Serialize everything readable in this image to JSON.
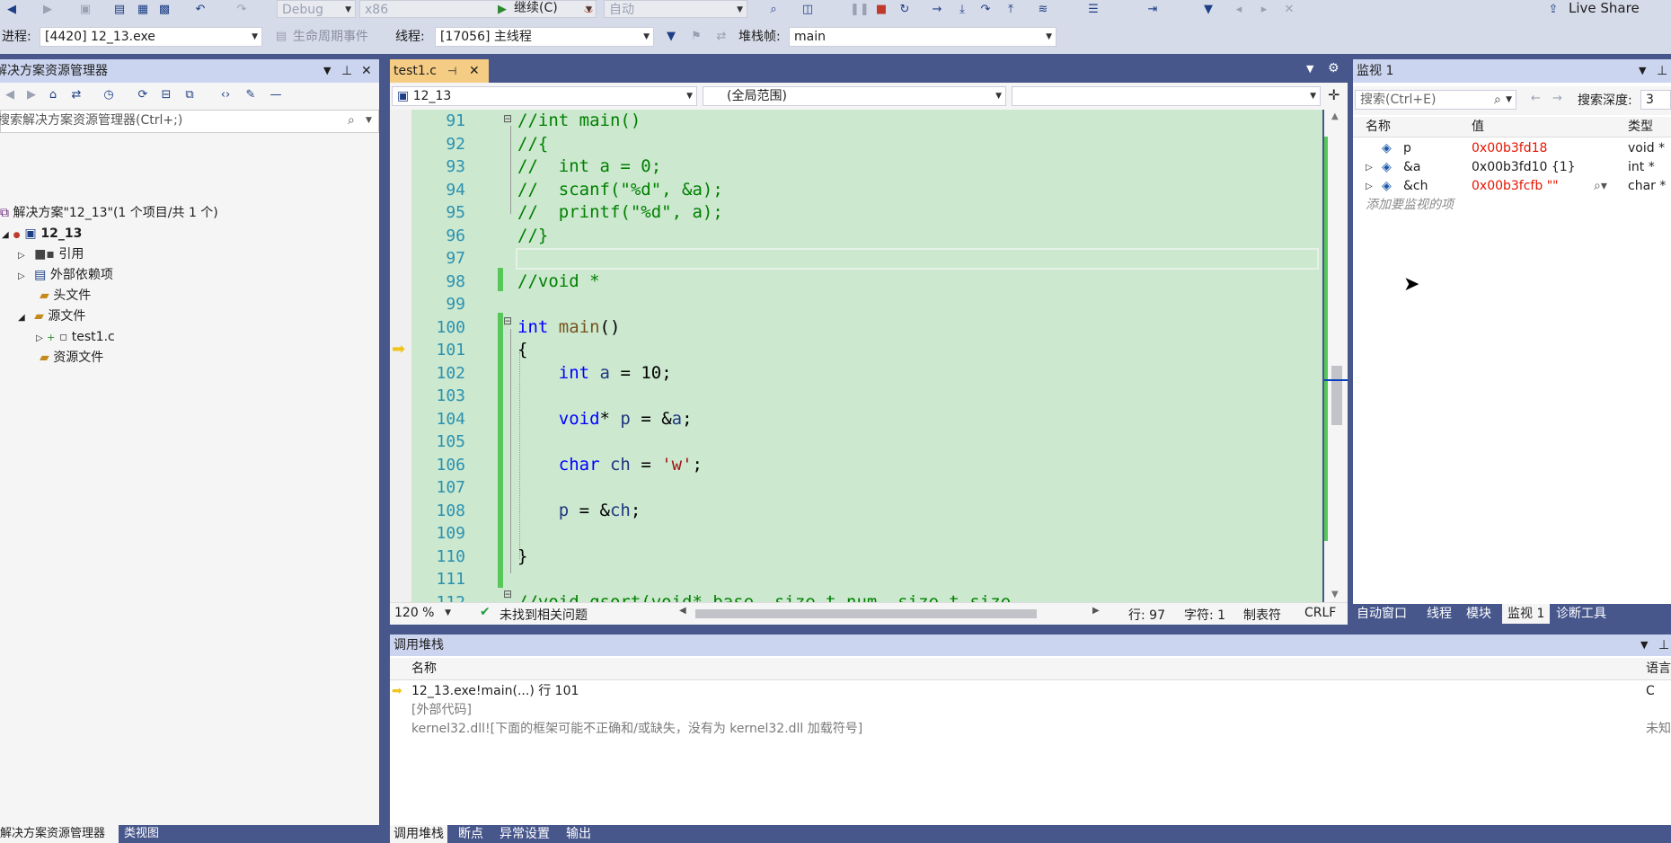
{
  "toolbar": {
    "config": "Debug",
    "platform": "x86",
    "continue_label": "继续(C)",
    "auto": "自动",
    "live_share": "Live Share",
    "process_label": "进程:",
    "process_value": "[4420] 12_13.exe",
    "lifecycle_label": "生命周期事件",
    "thread_label": "线程:",
    "thread_value": "[17056] 主线程",
    "stackframe_label": "堆栈帧:",
    "stackframe_value": "main"
  },
  "solution_explorer": {
    "title": "解决方案资源管理器",
    "search_placeholder": "搜索解决方案资源管理器(Ctrl+;)",
    "solution": "解决方案\"12_13\"(1 个项目/共 1 个)",
    "project": "12_13",
    "items": [
      "引用",
      "外部依赖项",
      "头文件",
      "源文件",
      "test1.c",
      "资源文件"
    ],
    "tabs": [
      "解决方案资源管理器",
      "类视图"
    ]
  },
  "editor": {
    "tab_name": "test1.c",
    "project_dropdown": "12_13",
    "scope_dropdown": "(全局范围)",
    "lines": [
      {
        "n": "91",
        "t": "//int main()"
      },
      {
        "n": "92",
        "t": "//{"
      },
      {
        "n": "93",
        "t": "//  int a = 0;"
      },
      {
        "n": "94",
        "t": "//  scanf(\"%d\", &a);"
      },
      {
        "n": "95",
        "t": "//  printf(\"%d\", a);"
      },
      {
        "n": "96",
        "t": "//}"
      },
      {
        "n": "97",
        "t": ""
      },
      {
        "n": "98",
        "t": "//void *"
      },
      {
        "n": "99",
        "t": ""
      },
      {
        "n": "100",
        "t": "int main()"
      },
      {
        "n": "101",
        "t": "{"
      },
      {
        "n": "102",
        "t": "    int a = 10;"
      },
      {
        "n": "103",
        "t": ""
      },
      {
        "n": "104",
        "t": "    void* p = &a;"
      },
      {
        "n": "105",
        "t": ""
      },
      {
        "n": "106",
        "t": "    char ch = 'w';"
      },
      {
        "n": "107",
        "t": ""
      },
      {
        "n": "108",
        "t": "    p = &ch;"
      },
      {
        "n": "109",
        "t": ""
      },
      {
        "n": "110",
        "t": "}"
      },
      {
        "n": "111",
        "t": ""
      },
      {
        "n": "112",
        "t": "//void qsort(void* base, size_t num, size_t size"
      }
    ],
    "status": {
      "zoom": "120 %",
      "issues": "未找到相关问题",
      "line": "行: 97",
      "char": "字符: 1",
      "tabs": "制表符",
      "eol": "CRLF"
    }
  },
  "watch": {
    "title": "监视 1",
    "search_placeholder": "搜索(Ctrl+E)",
    "depth_label": "搜索深度:",
    "depth_value": "3",
    "headers": [
      "名称",
      "值",
      "类型"
    ],
    "rows": [
      {
        "name": "p",
        "value": "0x00b3fd18",
        "type": "void *"
      },
      {
        "name": "&a",
        "value": "0x00b3fd10 {1}",
        "type": "int *"
      },
      {
        "name": "&ch",
        "value": "0x00b3fcfb \"\"",
        "type": "char *"
      }
    ],
    "add_hint": "添加要监视的项",
    "tabs": [
      "自动窗口",
      "线程",
      "模块",
      "监视 1",
      "诊断工具"
    ]
  },
  "callstack": {
    "title": "调用堆栈",
    "headers": [
      "名称",
      "语言"
    ],
    "rows": [
      {
        "name": "12_13.exe!main(...) 行 101",
        "lang": "C"
      },
      {
        "name": "[外部代码]",
        "lang": ""
      },
      {
        "name": "kernel32.dll![下面的框架可能不正确和/或缺失，没有为 kernel32.dll 加载符号]",
        "lang": "未知"
      }
    ],
    "tabs": [
      "调用堆栈",
      "断点",
      "异常设置",
      "输出"
    ]
  }
}
